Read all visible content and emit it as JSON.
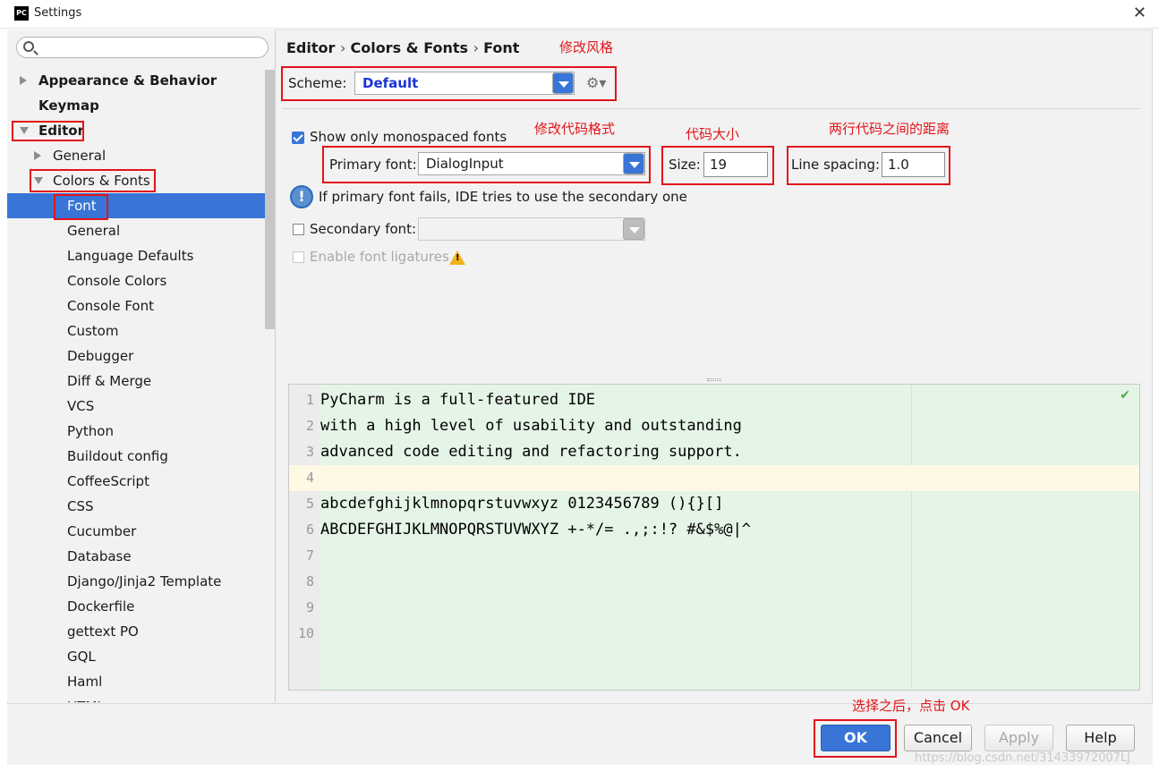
{
  "window": {
    "title": "Settings",
    "app_icon": "PC"
  },
  "search": {
    "placeholder": ""
  },
  "breadcrumb": [
    "Editor",
    "Colors & Fonts",
    "Font"
  ],
  "sidebar": {
    "items": [
      {
        "label": "Appearance & Behavior",
        "level": 0,
        "bold": true,
        "arrow": "right"
      },
      {
        "label": "Keymap",
        "level": 0,
        "bold": true,
        "arrow": ""
      },
      {
        "label": "Editor",
        "level": 0,
        "bold": true,
        "arrow": "down"
      },
      {
        "label": "General",
        "level": 1,
        "bold": false,
        "arrow": "right"
      },
      {
        "label": "Colors & Fonts",
        "level": 1,
        "bold": false,
        "arrow": "down"
      },
      {
        "label": "Font",
        "level": 2,
        "bold": false,
        "arrow": "",
        "selected": true
      },
      {
        "label": "General",
        "level": 2,
        "bold": false,
        "arrow": ""
      },
      {
        "label": "Language Defaults",
        "level": 2,
        "bold": false,
        "arrow": ""
      },
      {
        "label": "Console Colors",
        "level": 2,
        "bold": false,
        "arrow": ""
      },
      {
        "label": "Console Font",
        "level": 2,
        "bold": false,
        "arrow": ""
      },
      {
        "label": "Custom",
        "level": 2,
        "bold": false,
        "arrow": ""
      },
      {
        "label": "Debugger",
        "level": 2,
        "bold": false,
        "arrow": ""
      },
      {
        "label": "Diff & Merge",
        "level": 2,
        "bold": false,
        "arrow": ""
      },
      {
        "label": "VCS",
        "level": 2,
        "bold": false,
        "arrow": ""
      },
      {
        "label": "Python",
        "level": 2,
        "bold": false,
        "arrow": ""
      },
      {
        "label": "Buildout config",
        "level": 2,
        "bold": false,
        "arrow": ""
      },
      {
        "label": "CoffeeScript",
        "level": 2,
        "bold": false,
        "arrow": ""
      },
      {
        "label": "CSS",
        "level": 2,
        "bold": false,
        "arrow": ""
      },
      {
        "label": "Cucumber",
        "level": 2,
        "bold": false,
        "arrow": ""
      },
      {
        "label": "Database",
        "level": 2,
        "bold": false,
        "arrow": ""
      },
      {
        "label": "Django/Jinja2 Template",
        "level": 2,
        "bold": false,
        "arrow": ""
      },
      {
        "label": "Dockerfile",
        "level": 2,
        "bold": false,
        "arrow": ""
      },
      {
        "label": "gettext PO",
        "level": 2,
        "bold": false,
        "arrow": ""
      },
      {
        "label": "GQL",
        "level": 2,
        "bold": false,
        "arrow": ""
      },
      {
        "label": "Haml",
        "level": 2,
        "bold": false,
        "arrow": ""
      },
      {
        "label": "HTML",
        "level": 2,
        "bold": false,
        "arrow": ""
      }
    ]
  },
  "scheme": {
    "label": "Scheme:",
    "value": "Default"
  },
  "fonts": {
    "monospaced_label": "Show only monospaced fonts",
    "monospaced_checked": true,
    "primary_label": "Primary font:",
    "primary_value": "DialogInput",
    "size_label": "Size:",
    "size_value": "19",
    "spacing_label": "Line spacing:",
    "spacing_value": "1.0",
    "info_text": "If primary font fails, IDE tries to use the secondary one",
    "secondary_label": "Secondary font:",
    "secondary_value": "",
    "secondary_checked": false,
    "ligatures_label": "Enable font ligatures",
    "ligatures_checked": false
  },
  "annotations": {
    "scheme": "修改风格",
    "font": "修改代码格式",
    "size": "代码大小",
    "spacing": "两行代码之间的距离",
    "ok": "选择之后，点击 OK"
  },
  "preview": {
    "lines": [
      {
        "n": "1",
        "text": "PyCharm is a full-featured IDE"
      },
      {
        "n": "2",
        "text": "with a high level of usability and outstanding"
      },
      {
        "n": "3",
        "text": "advanced code editing and refactoring support."
      },
      {
        "n": "4",
        "text": ""
      },
      {
        "n": "5",
        "text": "abcdefghijklmnopqrstuvwxyz 0123456789 (){}[]"
      },
      {
        "n": "6",
        "text": "ABCDEFGHIJKLMNOPQRSTUVWXYZ +-*/= .,;:!? #&$%@|^"
      },
      {
        "n": "7",
        "text": ""
      },
      {
        "n": "8",
        "text": ""
      },
      {
        "n": "9",
        "text": ""
      },
      {
        "n": "10",
        "text": ""
      }
    ],
    "caret_line": 4
  },
  "buttons": {
    "ok": "OK",
    "cancel": "Cancel",
    "apply": "Apply",
    "help": "Help"
  },
  "watermark": "https://blog.csdn.net/31433972007LJ",
  "colors": {
    "accent": "#3875d7",
    "annotation": "#e3141a",
    "preview_bg": "#e4f4e6"
  }
}
